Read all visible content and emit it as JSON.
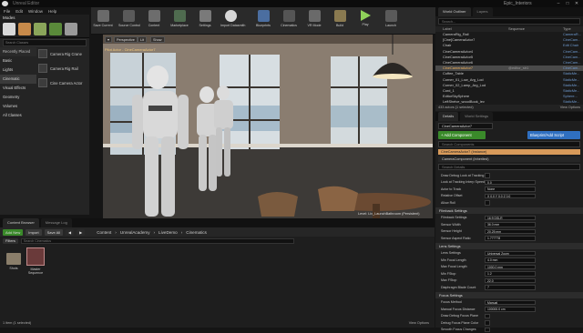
{
  "window": {
    "title": "Unreal Editor",
    "project": "Epic_Interiors"
  },
  "menu": [
    "File",
    "Edit",
    "Window",
    "Help"
  ],
  "modes_panel": {
    "tab": "Modes",
    "search_placeholder": "Search Classes",
    "categories": [
      "Recently Placed",
      "Basic",
      "Lights",
      "Cinematic",
      "Visual Effects",
      "Geometry",
      "Volumes",
      "All Classes"
    ],
    "selected_category": "Cinematic",
    "items": [
      "Camera Rig Crane",
      "Camera Rig Rail",
      "Cine Camera Actor"
    ]
  },
  "toolbar": [
    "Save Current",
    "Source Control",
    "Content",
    "Marketplace",
    "Settings",
    "Import Datasmith",
    "Blueprints",
    "Cinematics",
    "VR Mode",
    "Build",
    "Play",
    "Launch"
  ],
  "viewport": {
    "buttons": [
      "Perspective",
      "Lit",
      "Show"
    ],
    "info": "Pilot Actor - CineCameraActor7",
    "level": "Level: Liv_LaunchBathroom (Persistent)"
  },
  "outliner": {
    "tabs": [
      "World Outliner",
      "Layers"
    ],
    "search_placeholder": "Search...",
    "columns": [
      "Label",
      "Sequence",
      "Type"
    ],
    "rows": [
      {
        "label": "CameraRig_Rail",
        "seq": "",
        "type": "CameraR..."
      },
      {
        "label": "[Cine]CameraActor7",
        "seq": "",
        "type": "CineCam..."
      },
      {
        "label": "Chair",
        "seq": "",
        "type": "Edit Chair"
      },
      {
        "label": "CineCameraActor4",
        "seq": "",
        "type": "CineCam..."
      },
      {
        "label": "CineCameraActor5",
        "seq": "",
        "type": "CineCam..."
      },
      {
        "label": "CineCameraActor6",
        "seq": "",
        "type": "CineCam..."
      },
      {
        "label": "CineCameraActor7",
        "seq": "@editor_str1",
        "type": "CineCam..."
      },
      {
        "label": "Coffee_Table",
        "seq": "",
        "type": "StaticMe..."
      },
      {
        "label": "Corner_01_Low_Arg_Lod",
        "seq": "",
        "type": "StaticMe..."
      },
      {
        "label": "Corner_02_Lamp_Arg_Lod",
        "seq": "",
        "type": "StaticMe..."
      },
      {
        "label": "Cord_1",
        "seq": "",
        "type": "StaticMe..."
      },
      {
        "label": "EditorSkySphere",
        "seq": "",
        "type": "Sphere..."
      },
      {
        "label": "LeftShelve_woodBook_lev",
        "seq": "",
        "type": "StaticMe..."
      }
    ],
    "footer": "433 actors (1 selected)",
    "view_options": "View Options"
  },
  "details": {
    "tabs": [
      "Details",
      "World Settings"
    ],
    "name": "CineCameraActor7",
    "add_component": "+ Add Component",
    "blueprint": "Blueprint/Add Script",
    "search_placeholder": "Search Components",
    "instance": "CineCameraActor7 (Instance)",
    "component": "CameraComponent (Inherited)",
    "search_details": "Search Details",
    "props": [
      {
        "label": "Draw Debug Look at Tracking",
        "value": ""
      },
      {
        "label": "Look at Tracking Interp Speed",
        "value": "0.0"
      },
      {
        "label": "Actor to Track",
        "value": "None"
      },
      {
        "label": "Relative Offset",
        "value": "X 0.0   Y 0.0   Z 0.0"
      },
      {
        "label": "Allow Roll",
        "value": ""
      }
    ],
    "filmback_section": "Filmback Settings",
    "filmback": [
      {
        "label": "Filmback Settings",
        "value": "16:9 DSLR"
      },
      {
        "label": "Sensor Width",
        "value": "36.0 mm"
      },
      {
        "label": "Sensor Height",
        "value": "20.25 mm"
      },
      {
        "label": "Sensor Aspect Ratio",
        "value": "1.777778"
      }
    ],
    "lens_section": "Lens Settings",
    "lens": [
      {
        "label": "Lens Settings",
        "value": "Universal Zoom"
      },
      {
        "label": "Min Focal Length",
        "value": "4.0 mm"
      },
      {
        "label": "Max Focal Length",
        "value": "1000.0 mm"
      },
      {
        "label": "Min FStop",
        "value": "1.2"
      },
      {
        "label": "Max FStop",
        "value": "22.0"
      },
      {
        "label": "Diaphragm Blade Count",
        "value": "7"
      }
    ],
    "focus_section": "Focus Settings",
    "focus": [
      {
        "label": "Focus Method",
        "value": "Manual"
      },
      {
        "label": "Manual Focus Distance",
        "value": "100000.0 cm"
      },
      {
        "label": "Draw Debug Focus Plane",
        "value": ""
      },
      {
        "label": "Debug Focus Plane Color",
        "value": ""
      },
      {
        "label": "Smooth Focus Changes",
        "value": ""
      }
    ]
  },
  "content_browser": {
    "tabs": [
      "Content Browser",
      "Message Log"
    ],
    "add_new": "Add New",
    "import": "Import",
    "save_all": "Save All",
    "crumbs": [
      "Content",
      "UnrealAcademy",
      "LiveDemo",
      "Cinematics"
    ],
    "filters": "Filters",
    "search_placeholder": "Search Cinematics",
    "assets": [
      {
        "name": "Shots"
      },
      {
        "name": "Master Sequence"
      }
    ],
    "footer": "1 item (1 selected)",
    "view_options": "View Options"
  },
  "colors": {
    "accent_orange": "#f0a848",
    "add_component_green": "#3a8a2a",
    "blueprint_blue": "#2f6fc0"
  }
}
